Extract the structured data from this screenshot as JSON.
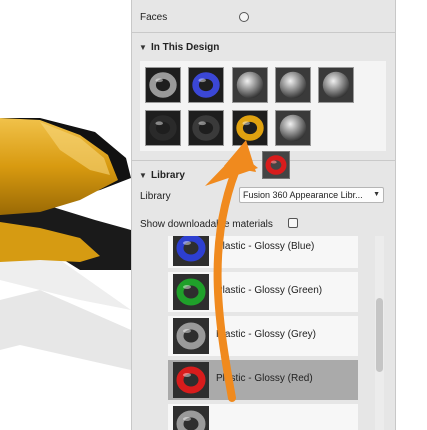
{
  "faces": {
    "label": "Faces"
  },
  "in_this_design": {
    "title": "In This Design",
    "swatches": [
      {
        "name": "swatch-1"
      },
      {
        "name": "swatch-2"
      },
      {
        "name": "swatch-3"
      },
      {
        "name": "swatch-4"
      },
      {
        "name": "swatch-5"
      },
      {
        "name": "swatch-6"
      },
      {
        "name": "swatch-7"
      },
      {
        "name": "swatch-8"
      },
      {
        "name": "swatch-9"
      }
    ]
  },
  "library": {
    "title": "Library",
    "label": "Library",
    "selected": "Fusion 360 Appearance Libr...",
    "show_downloadable_label": "Show downloadable materials",
    "items": [
      {
        "label": "Plastic - Glossy (Blue)",
        "color": "#2d3fd0"
      },
      {
        "label": "Plastic - Glossy (Green)",
        "color": "#1fa02a"
      },
      {
        "label": "Plastic - Glossy (Grey)",
        "color": "#9a9a9a"
      },
      {
        "label": "Plastic - Glossy (Red)",
        "color": "#d81c1c"
      },
      {
        "label": "",
        "color": "#9a9a9a"
      }
    ]
  },
  "colors": {
    "panel_bg": "#e6e6e6",
    "arrow": "#f08a1e",
    "yellow_plastic": "#e0a210"
  },
  "icons": {
    "section_toggle": "triangle-down-icon",
    "dropdown": "chevron-down-icon"
  }
}
